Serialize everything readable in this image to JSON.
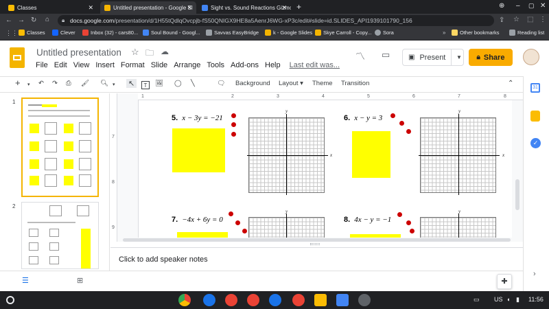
{
  "browser": {
    "tabs": [
      {
        "title": "Classes",
        "color": "#fbbc04"
      },
      {
        "title": "Untitled presentation - Google Sl",
        "color": "#f4b400"
      },
      {
        "title": "Sight vs. Sound Reactions Gizmo",
        "color": "#4285f4"
      }
    ],
    "new_tab": "+",
    "url_domain": "docs.google.com",
    "url_path": "/presentation/d/1H55tQdlqOvcpjb-fS50QNIGX9HE8a5AenrJ6WG-xP3c/edit#slide=id.SLIDES_API1939101790_156",
    "bookmarks": [
      "Classes",
      "Clever",
      "Inbox (32) - cars80...",
      "Soul Bound - Googl...",
      "Savvas EasyBridge",
      "k - Google Slides",
      "Skye Carroll - Copy...",
      "Sora"
    ],
    "other_bookmarks": "Other bookmarks",
    "reading_list": "Reading list"
  },
  "docs": {
    "title": "Untitled presentation",
    "menu": [
      "File",
      "Edit",
      "View",
      "Insert",
      "Format",
      "Slide",
      "Arrange",
      "Tools",
      "Add-ons",
      "Help"
    ],
    "last_edit": "Last edit was...",
    "present_label": "Present",
    "share_label": "Share"
  },
  "toolbar": {
    "background": "Background",
    "layout": "Layout",
    "theme": "Theme",
    "transition": "Transition"
  },
  "ruler": {
    "h_ticks": [
      "1",
      "2",
      "3",
      "4",
      "5",
      "6",
      "7",
      "8"
    ],
    "v_ticks": [
      "7",
      "8",
      "9"
    ]
  },
  "filmstrip": {
    "slide_numbers": [
      "1",
      "2"
    ]
  },
  "slide": {
    "problems": [
      {
        "num": "5.",
        "eq": "x − 3y = −21"
      },
      {
        "num": "6.",
        "eq": "x − y = 3"
      },
      {
        "num": "7.",
        "eq": "−4x + 6y = 0"
      },
      {
        "num": "8.",
        "eq": "4x − y = −1"
      }
    ],
    "axis_x": "x",
    "axis_y": "y",
    "highlight_color": "#ffff00",
    "dot_color": "#cc0000"
  },
  "notes": {
    "placeholder": "Click to add speaker notes"
  },
  "shelf": {
    "locale": "US",
    "time": "11:56"
  }
}
